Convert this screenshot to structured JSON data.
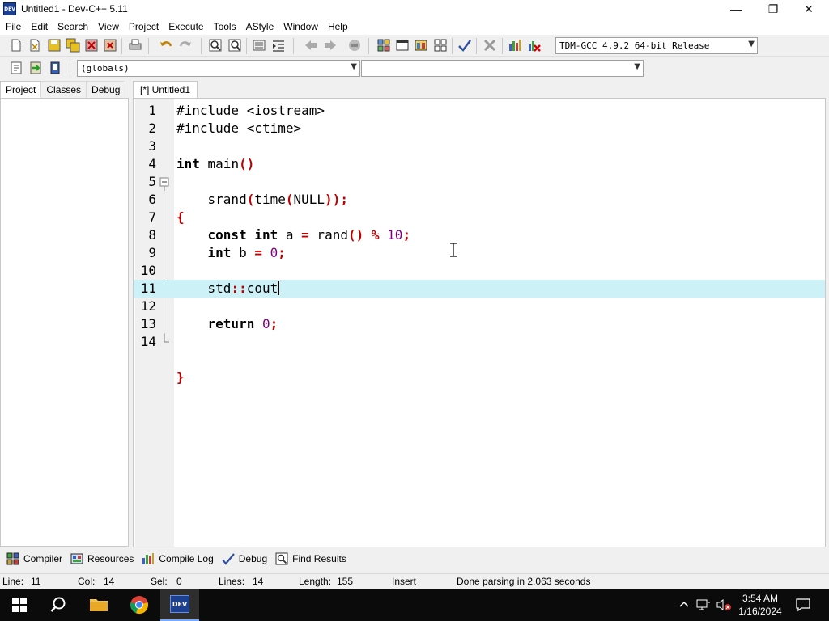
{
  "window": {
    "app_icon_text": "DEV",
    "title": "Untitled1 - Dev-C++ 5.11",
    "minimize_glyph": "—",
    "maximize_glyph": "❐",
    "close_glyph": "✕"
  },
  "menu": [
    "File",
    "Edit",
    "Search",
    "View",
    "Project",
    "Execute",
    "Tools",
    "AStyle",
    "Window",
    "Help"
  ],
  "toolbar": {
    "compiler_select": "TDM-GCC 4.9.2 64-bit Release",
    "scope_select": "(globals)",
    "member_select": ""
  },
  "left_panel": {
    "tabs": [
      "Project",
      "Classes",
      "Debug"
    ],
    "active_tab": "Project"
  },
  "editor": {
    "tab_label": "[*] Untitled1",
    "current_line": 11,
    "lines": [
      {
        "n": "1",
        "text": "#include <iostream>"
      },
      {
        "n": "2",
        "text": "#include <ctime>"
      },
      {
        "n": "3",
        "text": ""
      },
      {
        "n": "4",
        "text": "int main()"
      },
      {
        "n": "5",
        "text": "{"
      },
      {
        "n": "6",
        "text": "    srand(time(NULL));"
      },
      {
        "n": "7",
        "text": ""
      },
      {
        "n": "8",
        "text": "    const int a = rand() % 10;"
      },
      {
        "n": "9",
        "text": "    int b = 0;"
      },
      {
        "n": "10",
        "text": ""
      },
      {
        "n": "11",
        "text": "    std::cout"
      },
      {
        "n": "12",
        "text": ""
      },
      {
        "n": "13",
        "text": "    return 0;"
      },
      {
        "n": "14",
        "text": "}"
      }
    ]
  },
  "bottom_tabs": [
    {
      "label": "Compiler",
      "icon": "compiler-icon"
    },
    {
      "label": "Resources",
      "icon": "resources-icon"
    },
    {
      "label": "Compile Log",
      "icon": "compile-log-icon"
    },
    {
      "label": "Debug",
      "icon": "debug-check-icon"
    },
    {
      "label": "Find Results",
      "icon": "find-results-icon"
    }
  ],
  "status": {
    "line_label": "Line:",
    "line_value": "11",
    "col_label": "Col:",
    "col_value": "14",
    "sel_label": "Sel:",
    "sel_value": "0",
    "lines_label": "Lines:",
    "lines_value": "14",
    "length_label": "Length:",
    "length_value": "155",
    "mode": "Insert",
    "message": "Done parsing in 2.063 seconds"
  },
  "taskbar": {
    "time": "3:54 AM",
    "date": "1/16/2024",
    "active_app_icon_text": "DEV"
  },
  "colors": {
    "current_line": "#ccf2f8",
    "symbol": "#c00000",
    "number": "#800080",
    "taskbar": "#0b0b0b"
  }
}
